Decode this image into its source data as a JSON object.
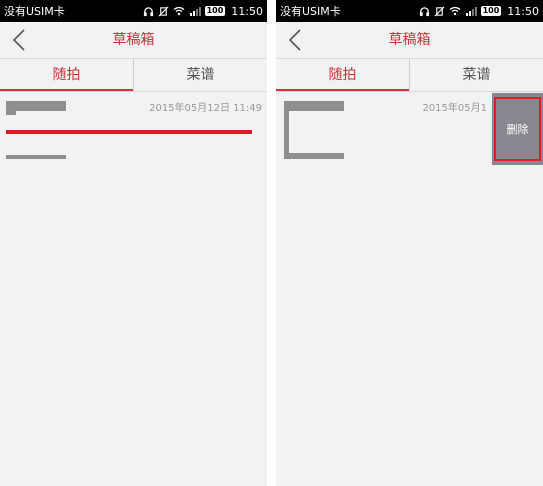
{
  "status_bar": {
    "carrier": "没有USIM卡",
    "battery": "100",
    "left_time": "11:50",
    "right_time": "11:50"
  },
  "header": {
    "title": "草稿箱"
  },
  "tabs": [
    {
      "label": "随拍",
      "active": true
    },
    {
      "label": "菜谱",
      "active": false
    }
  ],
  "left_item": {
    "date": "2015年05月12日 11:49"
  },
  "right_item": {
    "date": "2015年05月1",
    "delete_label": "删除"
  },
  "colors": {
    "accent": "#c8343c",
    "highlight_red": "#e21b23",
    "delete_bg": "#8a8690"
  }
}
